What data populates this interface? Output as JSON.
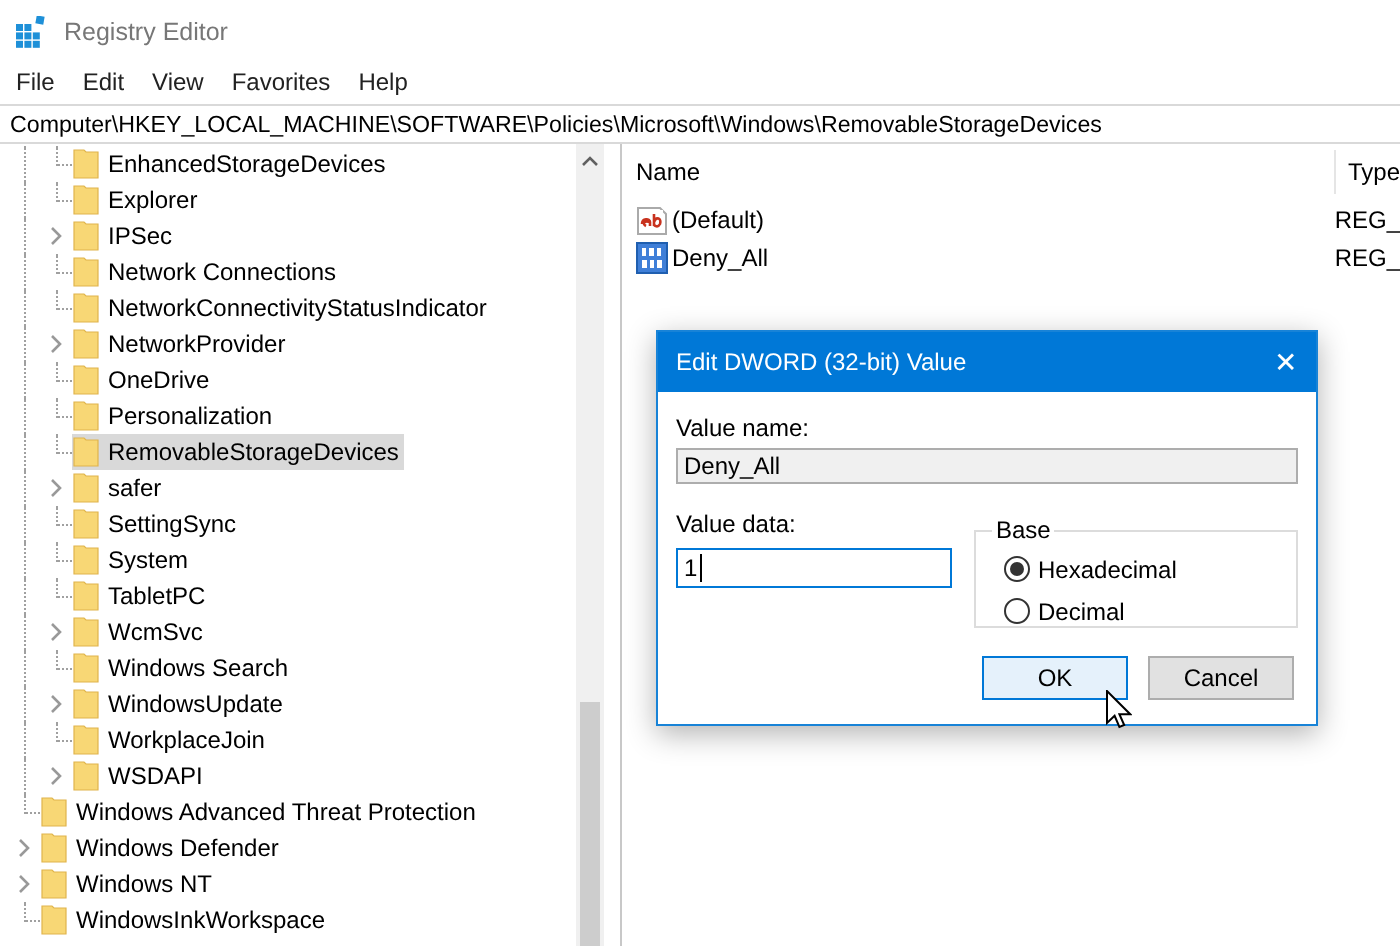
{
  "window": {
    "title": "Registry Editor"
  },
  "menu": [
    "File",
    "Edit",
    "View",
    "Favorites",
    "Help"
  ],
  "address_bar": "Computer\\HKEY_LOCAL_MACHINE\\SOFTWARE\\Policies\\Microsoft\\Windows\\RemovableStorageDevices",
  "tree": [
    {
      "children": [
        {
          "label": "EnhancedStorageDevices",
          "expandable": false,
          "selected": false
        },
        {
          "label": "Explorer",
          "expandable": false,
          "selected": false
        },
        {
          "label": "IPSec",
          "expandable": true,
          "selected": false
        },
        {
          "label": "Network Connections",
          "expandable": false,
          "selected": false
        },
        {
          "label": "NetworkConnectivityStatusIndicator",
          "expandable": false,
          "selected": false
        },
        {
          "label": "NetworkProvider",
          "expandable": true,
          "selected": false
        },
        {
          "label": "OneDrive",
          "expandable": false,
          "selected": false
        },
        {
          "label": "Personalization",
          "expandable": false,
          "selected": false
        },
        {
          "label": "RemovableStorageDevices",
          "expandable": false,
          "selected": true
        },
        {
          "label": "safer",
          "expandable": true,
          "selected": false
        },
        {
          "label": "SettingSync",
          "expandable": false,
          "selected": false
        },
        {
          "label": "System",
          "expandable": false,
          "selected": false
        },
        {
          "label": "TabletPC",
          "expandable": false,
          "selected": false
        },
        {
          "label": "WcmSvc",
          "expandable": true,
          "selected": false
        },
        {
          "label": "Windows Search",
          "expandable": false,
          "selected": false
        },
        {
          "label": "WindowsUpdate",
          "expandable": true,
          "selected": false
        },
        {
          "label": "WorkplaceJoin",
          "expandable": false,
          "selected": false
        },
        {
          "label": "WSDAPI",
          "expandable": true,
          "selected": false
        }
      ]
    },
    {
      "label": "Windows Advanced Threat Protection",
      "expandable": false,
      "selected": false
    },
    {
      "label": "Windows Defender",
      "expandable": true,
      "selected": false
    },
    {
      "label": "Windows NT",
      "expandable": true,
      "selected": false
    },
    {
      "label": "WindowsInkWorkspace",
      "expandable": false,
      "selected": false
    }
  ],
  "values_list": {
    "columns": [
      "Name",
      "Type"
    ],
    "rows": [
      {
        "kind": "string",
        "name": "(Default)",
        "type": "REG_"
      },
      {
        "kind": "dword",
        "name": "Deny_All",
        "type": "REG_"
      }
    ]
  },
  "dialog": {
    "title": "Edit DWORD (32-bit) Value",
    "close": "✕",
    "value_name_label": "Value name:",
    "value_name": "Deny_All",
    "value_data_label": "Value data:",
    "value_data": "1",
    "base_label": "Base",
    "base_options": [
      {
        "label": "Hexadecimal",
        "selected": true
      },
      {
        "label": "Decimal",
        "selected": false
      }
    ],
    "buttons": [
      {
        "label": "OK",
        "default": true
      },
      {
        "label": "Cancel",
        "default": false
      }
    ]
  }
}
